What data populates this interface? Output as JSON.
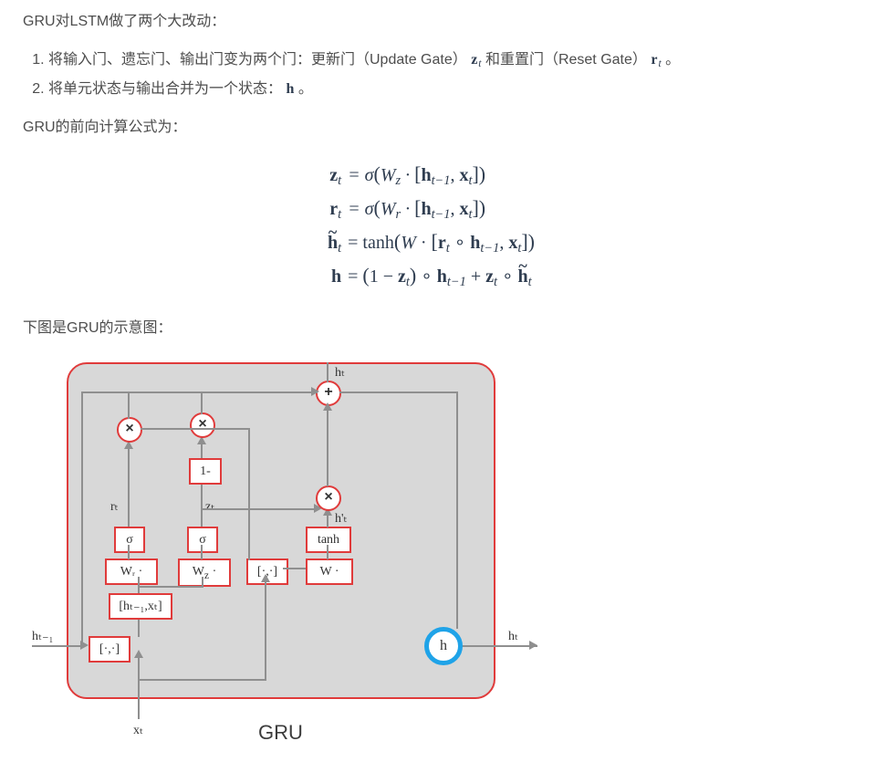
{
  "intro": "GRU对LSTM做了两个大改动：",
  "list_item1_a": "将输入门、遗忘门、输出门变为两个门：更新门（Update Gate）",
  "list_item1_b": "和重置门（Reset Gate）",
  "list_item1_c": "。",
  "list_item2_a": "将单元状态与输出合并为一个状态：",
  "list_item2_b": "。",
  "var_z": "z",
  "var_r": "r",
  "var_h": "h",
  "sub_t": "t",
  "para2": "GRU的前向计算公式为：",
  "eq1_l": "z",
  "eq1_r": " = σ(W",
  "eq1_r_sub": "z",
  "eq1_r2": " · [h",
  "eq1_r2s": "t−1",
  "eq1_r3": ", x",
  "eq1_r3s": "t",
  "eq1_r4": "])",
  "eq2_l": "r",
  "eq2_r_sub": "r",
  "eq3_l": "h",
  "eq3_r": " = tanh(W · [r",
  "eq3_r1s": "t",
  "eq3_r2": " ∘ h",
  "eq3_r2s": "t−1",
  "eq3_r3": ", x",
  "eq3_r3s": "t",
  "eq3_r4": "])",
  "eq4_l": "h",
  "eq4_r": " = (1 − z",
  "eq4_r1s": "t",
  "eq4_r2": ") ∘ h",
  "eq4_r2s": "t−1",
  "eq4_r3": " + z",
  "eq4_r3s": "t",
  "eq4_r4": " ∘ ",
  "eq4_r5": "h",
  "eq4_r5s": "t",
  "para3": "下图是GRU的示意图：",
  "diagram": {
    "h_prev": "hₜ₋₁",
    "h_out_top": "hₜ",
    "h_out_right": "hₜ",
    "x_in": "xₜ",
    "r_lbl": "rₜ",
    "z_lbl": "zₜ",
    "htilde_lbl": "h'ₜ",
    "concat1": "[·,·]",
    "concat2": "[·,·]",
    "hx_bracket": "[hₜ₋₁,xₜ]",
    "wr": "Wᵣ ·",
    "wz": "W_z ·",
    "w": "W ·",
    "sigma": "σ",
    "tanh": "tanh",
    "one_minus": "1-",
    "times": "×",
    "plus": "+",
    "h_val": "h",
    "title": "GRU"
  }
}
